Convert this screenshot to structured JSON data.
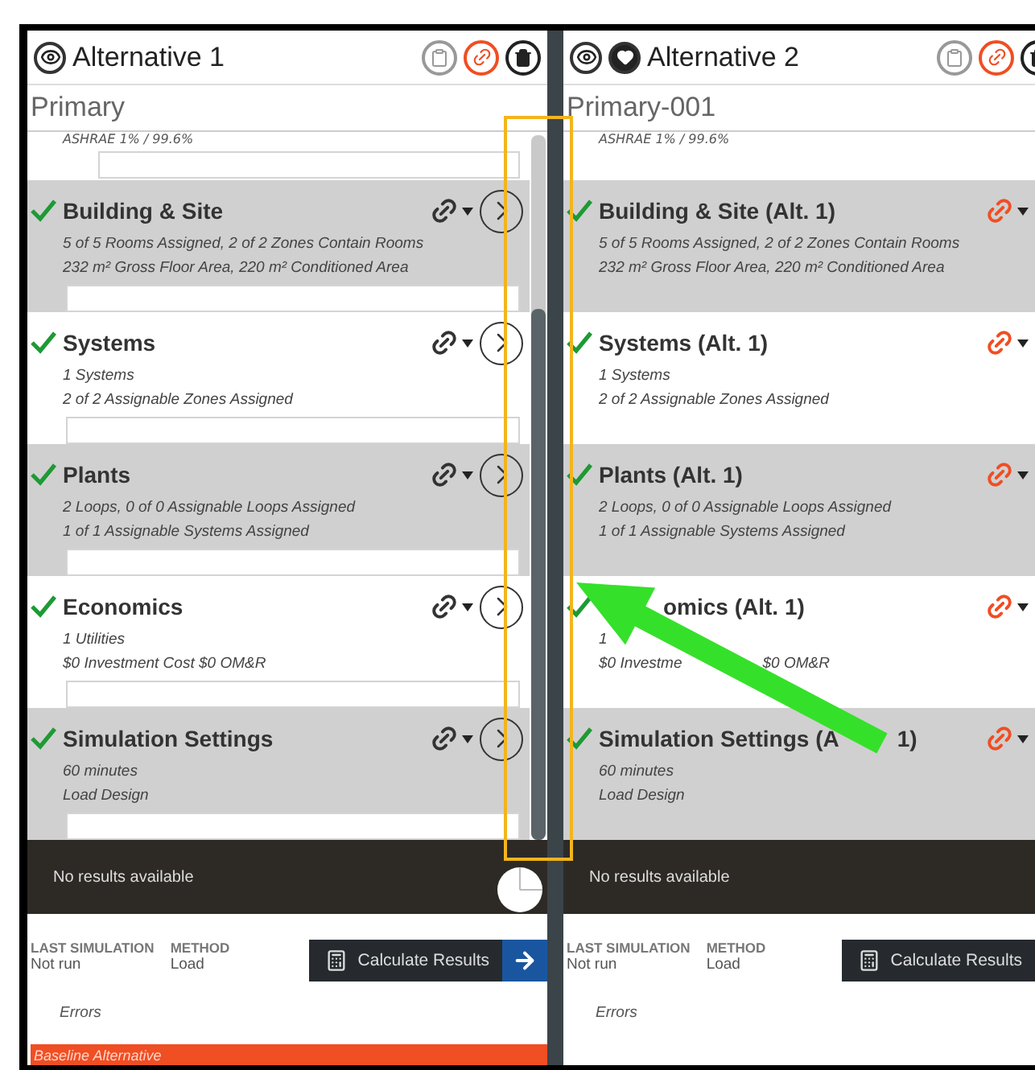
{
  "panels": [
    {
      "kind": "baseline",
      "title": "Alternative 1",
      "name": "Primary",
      "top_note": "ASHRAE 1% / 99.6%",
      "sections": [
        {
          "title": [
            "Building & Site"
          ],
          "lines": [
            [
              "5 of 5 Rooms Assigned, 2 of 2 Zones Contain Rooms"
            ],
            [
              "232 m² Gross Floor Area, 220 m² Conditioned Area"
            ]
          ],
          "complete": true,
          "shaded": true,
          "linked": false
        },
        {
          "title": [
            "Systems"
          ],
          "lines": [
            [
              "1 Systems"
            ],
            [
              "2 of 2 Assignable Zones Assigned"
            ]
          ],
          "complete": true,
          "shaded": false,
          "linked": false
        },
        {
          "title": [
            "Plants"
          ],
          "lines": [
            [
              "2 Loops, 0 of 0 Assignable Loops Assigned"
            ],
            [
              "1 of 1 Assignable Systems Assigned"
            ]
          ],
          "complete": true,
          "shaded": true,
          "linked": false
        },
        {
          "title": [
            "Economics"
          ],
          "lines": [
            [
              "1 Utilities"
            ],
            [
              "$0 Investment Cost $0 OM&R"
            ]
          ],
          "complete": true,
          "shaded": false,
          "linked": false
        },
        {
          "title": [
            "Simulation Settings"
          ],
          "lines": [
            [
              "60 minutes"
            ],
            [
              "Load Design"
            ]
          ],
          "complete": true,
          "shaded": true,
          "linked": false
        }
      ],
      "results": "No results available",
      "last_simulation_label": "LAST SIMULATION",
      "last_simulation": "Not run",
      "method_label": "METHOD",
      "method": "Load",
      "calculate": "Calculate Results",
      "errors": "Errors",
      "baseline": "Baseline Alternative"
    },
    {
      "kind": "alternative",
      "title": "Alternative 2",
      "name": "Primary-001",
      "top_note": "ASHRAE 1% / 99.6%",
      "sections": [
        {
          "title": [
            "Building & Site (Alt. 1)"
          ],
          "lines": [
            [
              "5 of 5 Rooms Assigned, 2 of 2 Zones Contain Rooms"
            ],
            [
              "232 m² Gross Floor Area, 220 m² Conditioned Area"
            ]
          ],
          "complete": true,
          "shaded": true,
          "linked": true
        },
        {
          "title": [
            "Systems (Alt. 1)"
          ],
          "lines": [
            [
              "1 Systems"
            ],
            [
              "2 of 2 Assignable Zones Assigned"
            ]
          ],
          "complete": true,
          "shaded": false,
          "linked": true
        },
        {
          "title": [
            "Plants (Alt. 1)"
          ],
          "lines": [
            [
              "2 Loops, 0 of 0 Assignable Loops Assigned"
            ],
            [
              "1 of 1 Assignable Systems Assigned"
            ]
          ],
          "complete": true,
          "shaded": true,
          "linked": true
        },
        {
          "title": [
            "omics (Alt. 1)"
          ],
          "lines": [
            [
              "1"
            ],
            [
              "$0 Investme",
              "$0 OM&R"
            ]
          ],
          "complete": true,
          "shaded": false,
          "linked": true,
          "lead_hidden": true
        },
        {
          "title": [
            "Simulation Settings (A",
            "1)"
          ],
          "lines": [
            [
              "60 minutes"
            ],
            [
              "Load Design"
            ]
          ],
          "complete": true,
          "shaded": true,
          "linked": true
        }
      ],
      "results": "No results available",
      "last_simulation_label": "LAST SIMULATION",
      "last_simulation": "Not run",
      "method_label": "METHOD",
      "method": "Load",
      "calculate": "Calculate Results",
      "errors": "Errors"
    }
  ]
}
